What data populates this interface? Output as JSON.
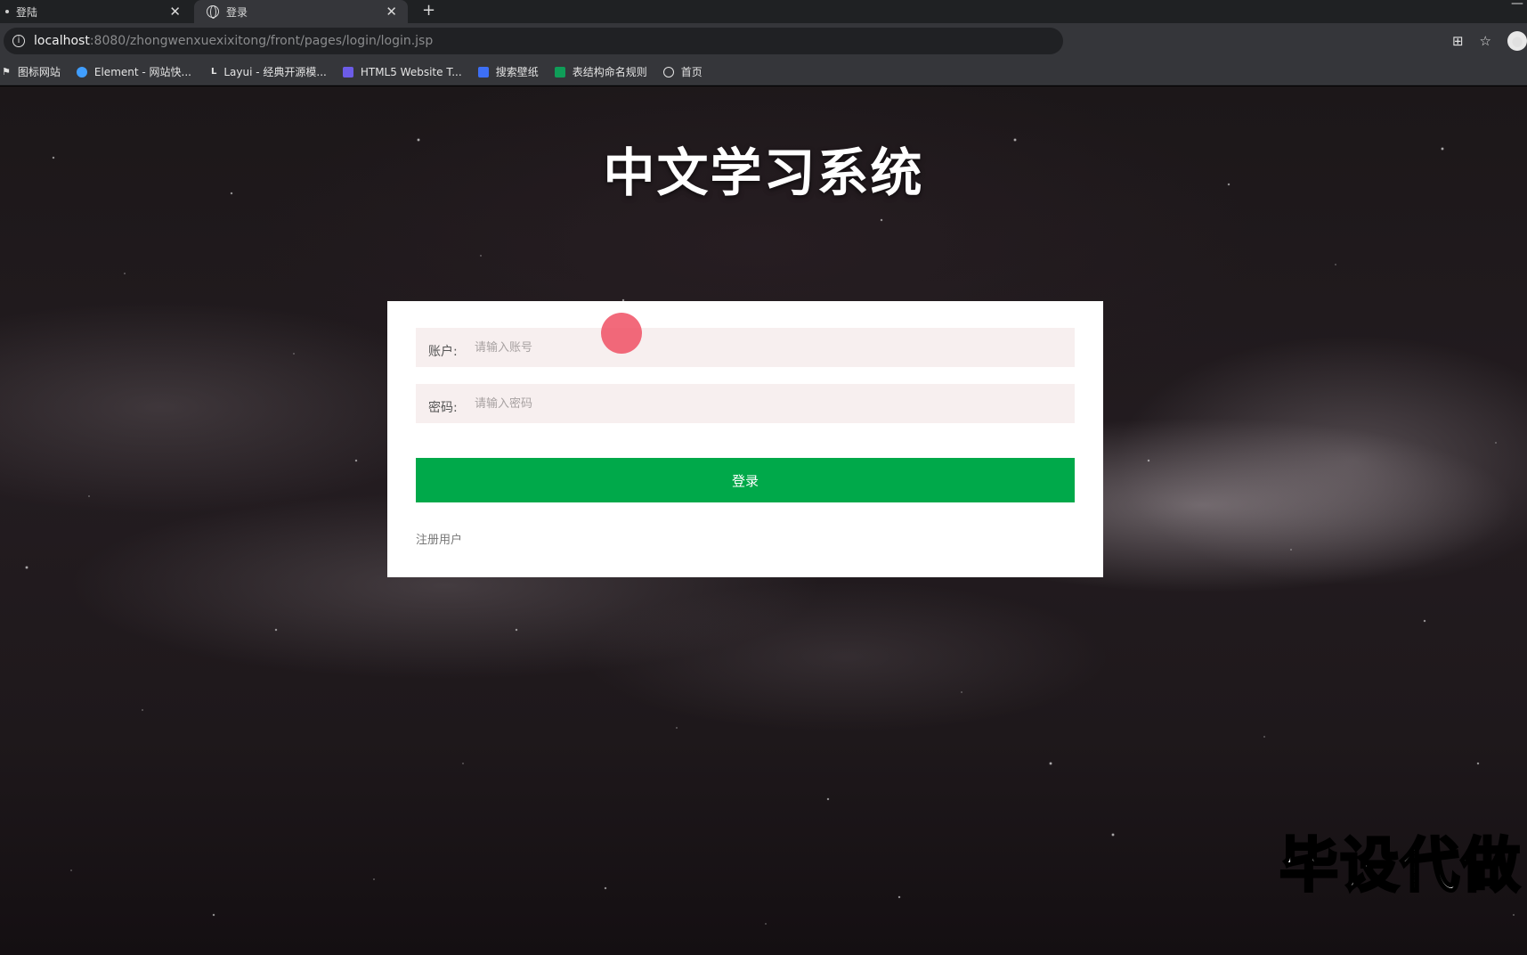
{
  "browser": {
    "tabs": [
      {
        "label": "登陆",
        "active": false
      },
      {
        "label": "登录",
        "active": true
      }
    ],
    "new_tab_symbol": "+",
    "close_symbol": "✕",
    "url_host": "localhost",
    "url_path": ":8080/zhongwenxuexixitong/front/pages/login/login.jsp",
    "bookmarks": [
      {
        "label": "图标网站",
        "icon": "flag-icon"
      },
      {
        "label": "Element - 网站快...",
        "icon": "element-icon"
      },
      {
        "label": "Layui - 经典开源模...",
        "icon": "layui-icon"
      },
      {
        "label": "HTML5 Website T...",
        "icon": "html5-icon"
      },
      {
        "label": "搜索壁纸",
        "icon": "search-bookmark-icon"
      },
      {
        "label": "表结构命名规则",
        "icon": "table-icon"
      },
      {
        "label": "首页",
        "icon": "globe-icon"
      }
    ]
  },
  "page": {
    "title": "中文学习系统",
    "form": {
      "account_label": "账户:",
      "account_placeholder": "请输入账号",
      "password_label": "密码:",
      "password_placeholder": "请输入密码",
      "login_button": "登录",
      "register_link": "注册用户"
    },
    "watermark": "毕设代做"
  },
  "colors": {
    "primary_button": "#00a94a",
    "input_background": "#f7efef",
    "cursor_highlight": "#f05064"
  }
}
